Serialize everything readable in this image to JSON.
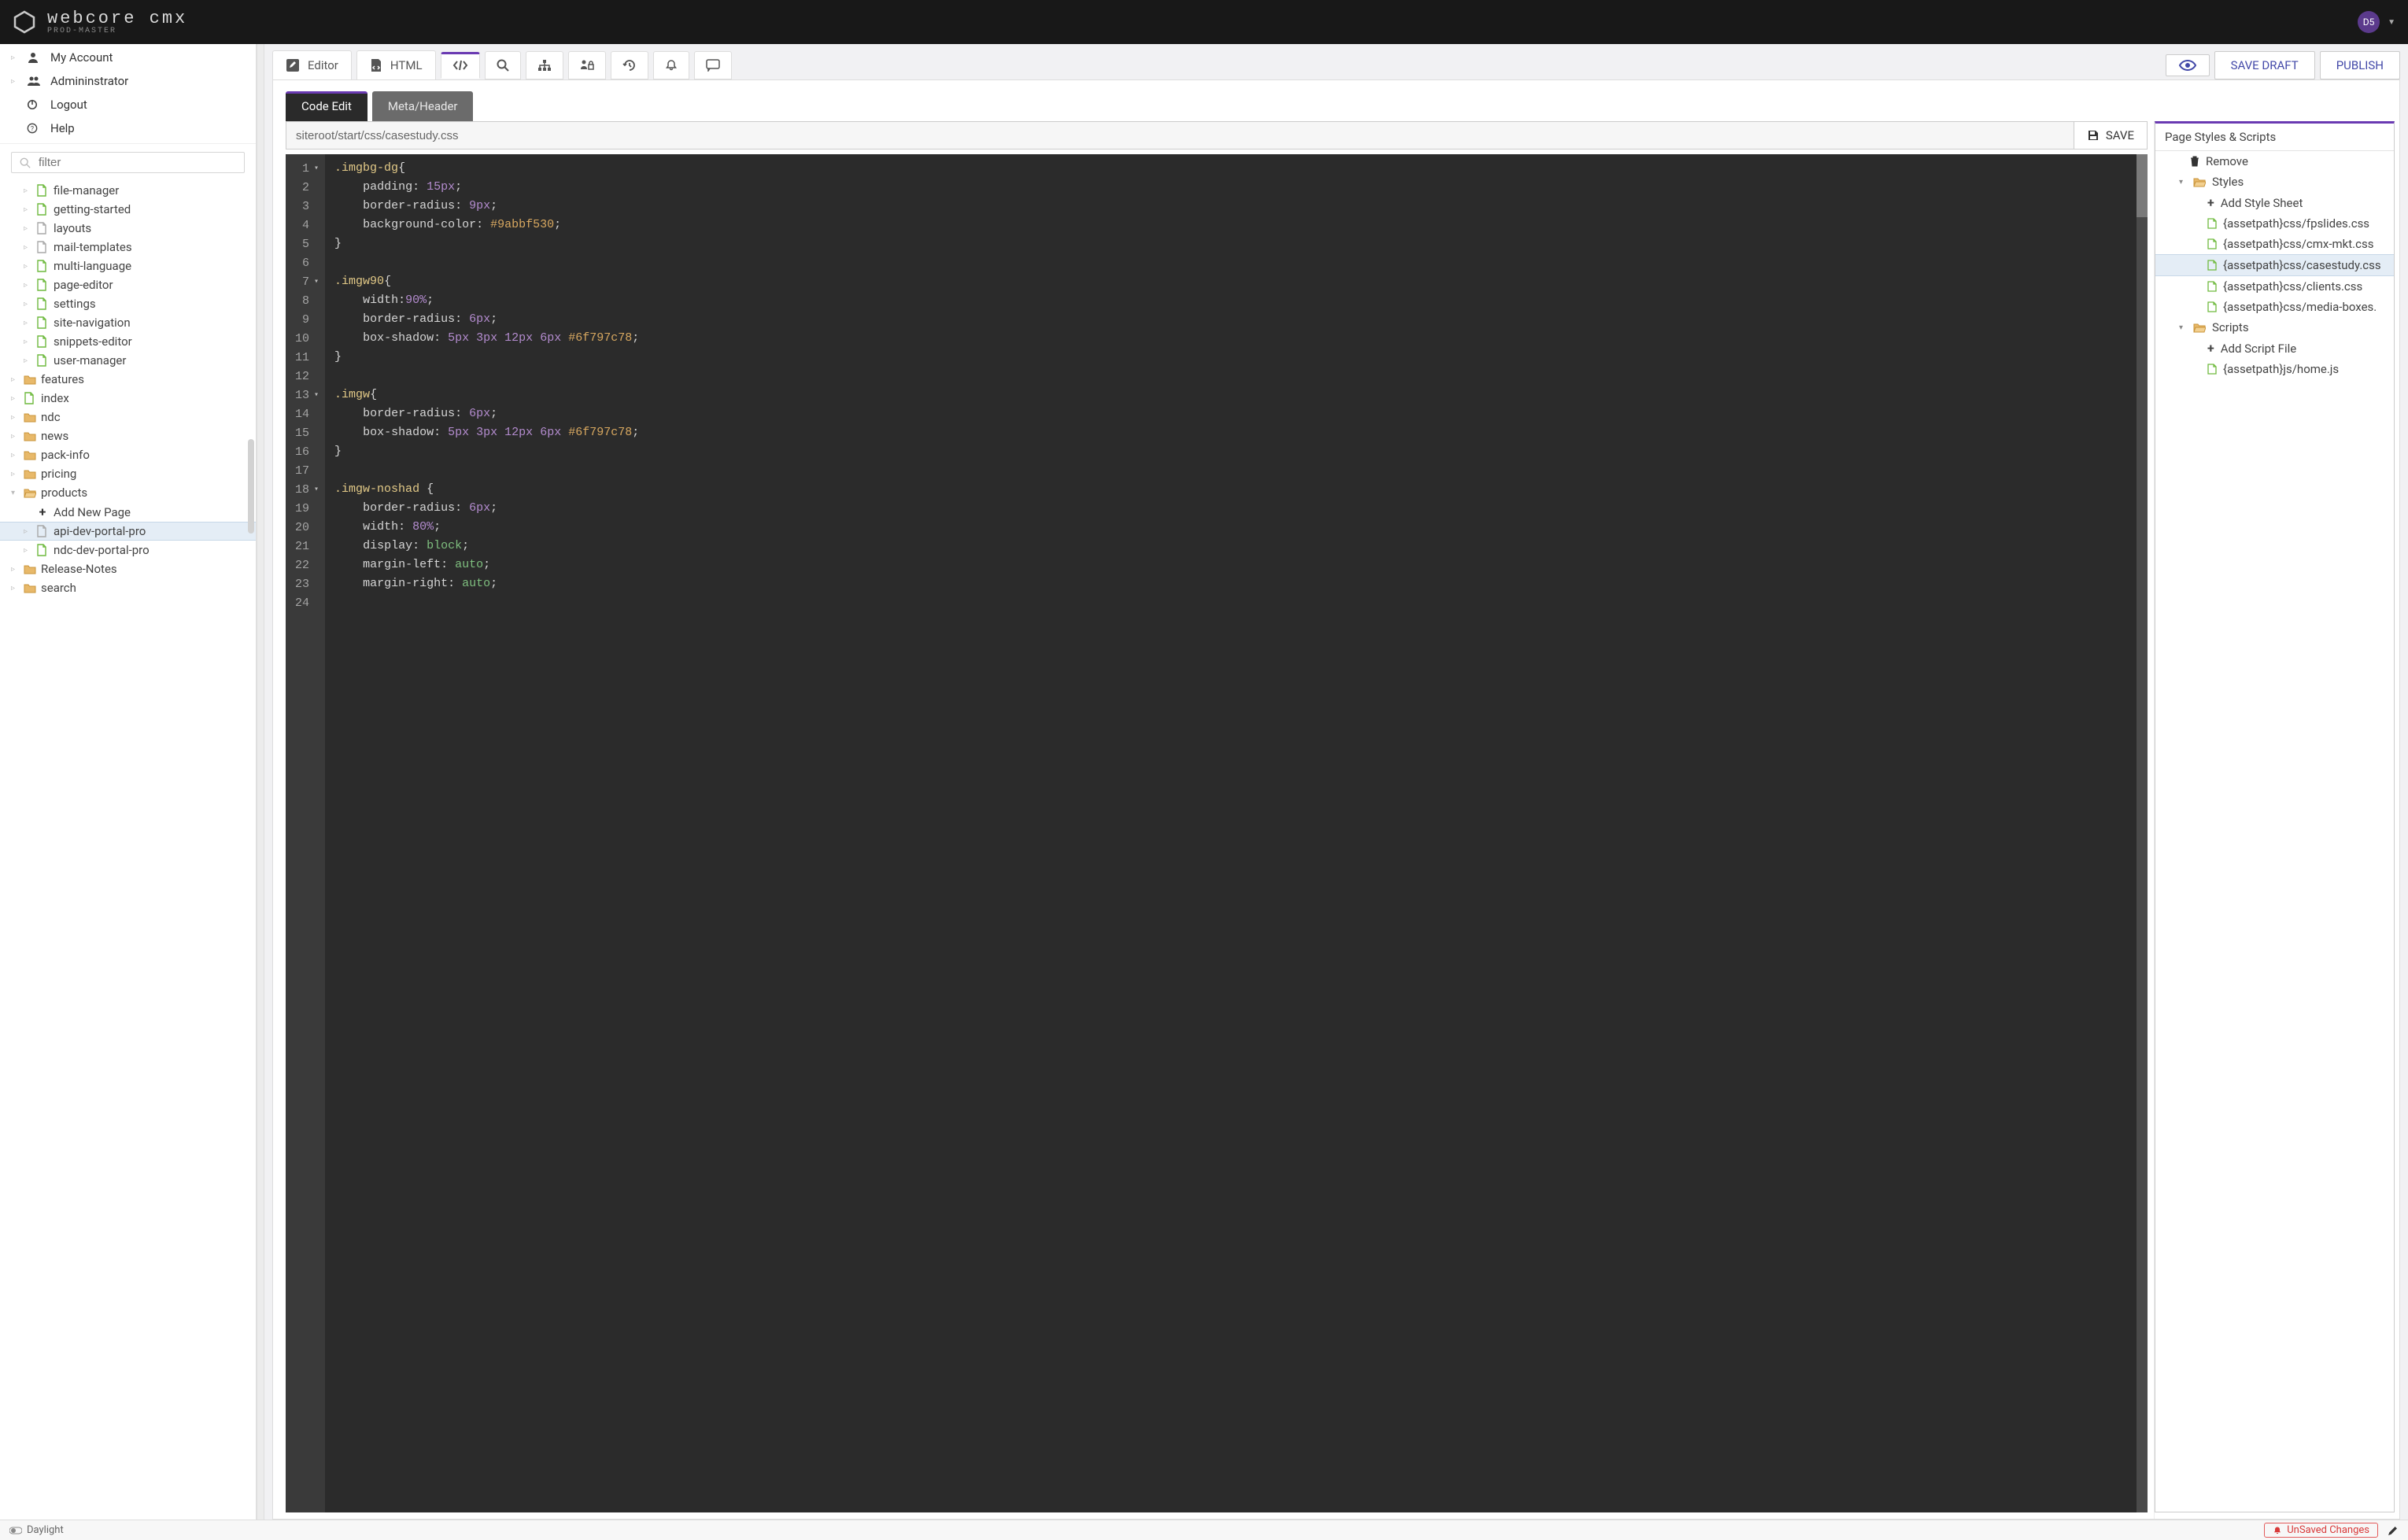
{
  "brand": {
    "name": "webcore cmx",
    "tagline": "PROD-MASTER"
  },
  "user": {
    "initials": "D5"
  },
  "sidebar": {
    "top": [
      {
        "icon": "user",
        "label": "My Account",
        "caret": true
      },
      {
        "icon": "users",
        "label": "Admininstrator",
        "caret": true
      },
      {
        "icon": "power",
        "label": "Logout",
        "caret": false
      },
      {
        "icon": "help",
        "label": "Help",
        "caret": false
      }
    ],
    "filter_placeholder": "filter",
    "tree": [
      {
        "d": 1,
        "caret": "▹",
        "icon": "page",
        "label": "file-manager"
      },
      {
        "d": 1,
        "caret": "▹",
        "icon": "page",
        "label": "getting-started"
      },
      {
        "d": 1,
        "caret": "▹",
        "icon": "page-g",
        "label": "layouts"
      },
      {
        "d": 1,
        "caret": "▹",
        "icon": "page-g",
        "label": "mail-templates"
      },
      {
        "d": 1,
        "caret": "▹",
        "icon": "page",
        "label": "multi-language"
      },
      {
        "d": 1,
        "caret": "▹",
        "icon": "page",
        "label": "page-editor"
      },
      {
        "d": 1,
        "caret": "▹",
        "icon": "page",
        "label": "settings"
      },
      {
        "d": 1,
        "caret": "▹",
        "icon": "page",
        "label": "site-navigation"
      },
      {
        "d": 1,
        "caret": "▹",
        "icon": "page",
        "label": "snippets-editor"
      },
      {
        "d": 1,
        "caret": "▹",
        "icon": "page",
        "label": "user-manager"
      },
      {
        "d": 0,
        "caret": "▹",
        "icon": "folder",
        "label": "features"
      },
      {
        "d": 0,
        "caret": "▹",
        "icon": "page",
        "label": "index"
      },
      {
        "d": 0,
        "caret": "▹",
        "icon": "folder",
        "label": "ndc"
      },
      {
        "d": 0,
        "caret": "▹",
        "icon": "folder",
        "label": "news"
      },
      {
        "d": 0,
        "caret": "▹",
        "icon": "folder",
        "label": "pack-info"
      },
      {
        "d": 0,
        "caret": "▹",
        "icon": "folder",
        "label": "pricing"
      },
      {
        "d": 0,
        "caret": "▾",
        "icon": "folder-o",
        "label": "products"
      },
      {
        "d": 1,
        "caret": "",
        "icon": "plus",
        "label": "Add New Page"
      },
      {
        "d": 1,
        "caret": "▹",
        "icon": "page-g",
        "label": "api-dev-portal-pro",
        "sel": true
      },
      {
        "d": 1,
        "caret": "▹",
        "icon": "page",
        "label": "ndc-dev-portal-pro"
      },
      {
        "d": 0,
        "caret": "▹",
        "icon": "folder",
        "label": "Release-Notes"
      },
      {
        "d": 0,
        "caret": "▹",
        "icon": "folder",
        "label": "search"
      }
    ]
  },
  "toolbar": {
    "tabs": [
      {
        "icon": "pencil-square",
        "label": "Editor"
      },
      {
        "icon": "file-code",
        "label": "HTML"
      },
      {
        "icon": "code",
        "label": "",
        "active": true
      },
      {
        "icon": "search",
        "label": ""
      },
      {
        "icon": "sitemap",
        "label": ""
      },
      {
        "icon": "perm",
        "label": ""
      },
      {
        "icon": "history",
        "label": ""
      },
      {
        "icon": "bell",
        "label": ""
      },
      {
        "icon": "comment",
        "label": ""
      }
    ],
    "actions": {
      "preview": "PREVIEW",
      "save_draft": "SAVE DRAFT",
      "publish": "PUBLISH"
    }
  },
  "subtabs": {
    "code_edit": "Code Edit",
    "meta_header": "Meta/Header"
  },
  "pathbar": {
    "path": "siteroot/start/css/casestudy.css",
    "save": "SAVE"
  },
  "editor": {
    "lines": [
      {
        "n": 1,
        "fold": "▾",
        "tokens": [
          [
            "sel",
            ".imgbg-dg"
          ],
          [
            "pun",
            "{"
          ]
        ]
      },
      {
        "n": 2,
        "fold": "",
        "tokens": [
          [
            "pad",
            "    "
          ],
          [
            "prop",
            "padding"
          ],
          [
            "pun",
            ": "
          ],
          [
            "num",
            "15px"
          ],
          [
            "pun",
            ";"
          ]
        ]
      },
      {
        "n": 3,
        "fold": "",
        "tokens": [
          [
            "pad",
            "    "
          ],
          [
            "prop",
            "border-radius"
          ],
          [
            "pun",
            ": "
          ],
          [
            "num",
            "9px"
          ],
          [
            "pun",
            ";"
          ]
        ]
      },
      {
        "n": 4,
        "fold": "",
        "tokens": [
          [
            "pad",
            "    "
          ],
          [
            "prop",
            "background-color"
          ],
          [
            "pun",
            ": "
          ],
          [
            "hex",
            "#9abbf530"
          ],
          [
            "pun",
            ";"
          ]
        ]
      },
      {
        "n": 5,
        "fold": "",
        "tokens": [
          [
            "pun",
            "}"
          ]
        ]
      },
      {
        "n": 6,
        "fold": "",
        "tokens": []
      },
      {
        "n": 7,
        "fold": "▾",
        "tokens": [
          [
            "sel",
            ".imgw90"
          ],
          [
            "pun",
            "{"
          ]
        ]
      },
      {
        "n": 8,
        "fold": "",
        "tokens": [
          [
            "pad",
            "    "
          ],
          [
            "prop",
            "width"
          ],
          [
            "pun",
            ":"
          ],
          [
            "num",
            "90%"
          ],
          [
            "pun",
            ";"
          ]
        ]
      },
      {
        "n": 9,
        "fold": "",
        "tokens": [
          [
            "pad",
            "    "
          ],
          [
            "prop",
            "border-radius"
          ],
          [
            "pun",
            ": "
          ],
          [
            "num",
            "6px"
          ],
          [
            "pun",
            ";"
          ]
        ]
      },
      {
        "n": 10,
        "fold": "",
        "tokens": [
          [
            "pad",
            "    "
          ],
          [
            "prop",
            "box-shadow"
          ],
          [
            "pun",
            ": "
          ],
          [
            "num",
            "5px"
          ],
          [
            "pun",
            " "
          ],
          [
            "num",
            "3px"
          ],
          [
            "pun",
            " "
          ],
          [
            "num",
            "12px"
          ],
          [
            "pun",
            " "
          ],
          [
            "num",
            "6px"
          ],
          [
            "pun",
            " "
          ],
          [
            "hex",
            "#6f797c78"
          ],
          [
            "pun",
            ";"
          ]
        ]
      },
      {
        "n": 11,
        "fold": "",
        "tokens": [
          [
            "pun",
            "}"
          ]
        ]
      },
      {
        "n": 12,
        "fold": "",
        "tokens": []
      },
      {
        "n": 13,
        "fold": "▾",
        "tokens": [
          [
            "sel",
            ".imgw"
          ],
          [
            "pun",
            "{"
          ]
        ]
      },
      {
        "n": 14,
        "fold": "",
        "tokens": [
          [
            "pad",
            "    "
          ],
          [
            "prop",
            "border-radius"
          ],
          [
            "pun",
            ": "
          ],
          [
            "num",
            "6px"
          ],
          [
            "pun",
            ";"
          ]
        ]
      },
      {
        "n": 15,
        "fold": "",
        "tokens": [
          [
            "pad",
            "    "
          ],
          [
            "prop",
            "box-shadow"
          ],
          [
            "pun",
            ": "
          ],
          [
            "num",
            "5px"
          ],
          [
            "pun",
            " "
          ],
          [
            "num",
            "3px"
          ],
          [
            "pun",
            " "
          ],
          [
            "num",
            "12px"
          ],
          [
            "pun",
            " "
          ],
          [
            "num",
            "6px"
          ],
          [
            "pun",
            " "
          ],
          [
            "hex",
            "#6f797c78"
          ],
          [
            "pun",
            ";"
          ]
        ]
      },
      {
        "n": 16,
        "fold": "",
        "tokens": [
          [
            "pun",
            "}"
          ]
        ]
      },
      {
        "n": 17,
        "fold": "",
        "tokens": []
      },
      {
        "n": 18,
        "fold": "▾",
        "tokens": [
          [
            "sel",
            ".imgw-noshad "
          ],
          [
            "pun",
            "{"
          ]
        ]
      },
      {
        "n": 19,
        "fold": "",
        "tokens": [
          [
            "pad",
            "    "
          ],
          [
            "prop",
            "border-radius"
          ],
          [
            "pun",
            ": "
          ],
          [
            "num",
            "6px"
          ],
          [
            "pun",
            ";"
          ]
        ]
      },
      {
        "n": 20,
        "fold": "",
        "tokens": [
          [
            "pad",
            "    "
          ],
          [
            "prop",
            "width"
          ],
          [
            "pun",
            ": "
          ],
          [
            "num",
            "80%"
          ],
          [
            "pun",
            ";"
          ]
        ]
      },
      {
        "n": 21,
        "fold": "",
        "tokens": [
          [
            "pad",
            "    "
          ],
          [
            "prop",
            "display"
          ],
          [
            "pun",
            ": "
          ],
          [
            "val",
            "block"
          ],
          [
            "pun",
            ";"
          ]
        ]
      },
      {
        "n": 22,
        "fold": "",
        "tokens": [
          [
            "pad",
            "    "
          ],
          [
            "prop",
            "margin-left"
          ],
          [
            "pun",
            ": "
          ],
          [
            "val",
            "auto"
          ],
          [
            "pun",
            ";"
          ]
        ]
      },
      {
        "n": 23,
        "fold": "",
        "tokens": [
          [
            "pad",
            "    "
          ],
          [
            "prop",
            "margin-right"
          ],
          [
            "pun",
            ": "
          ],
          [
            "val",
            "auto"
          ],
          [
            "pun",
            ";"
          ]
        ]
      },
      {
        "n": 24,
        "fold": "",
        "tokens": []
      }
    ]
  },
  "right_panel": {
    "title": "Page Styles & Scripts",
    "rows": [
      {
        "d": "d0",
        "icon": "trash",
        "label": "Remove"
      },
      {
        "d": "d1c",
        "caret": "▾",
        "icon": "folder-o",
        "label": "Styles"
      },
      {
        "d": "d2",
        "icon": "plus",
        "label": "Add Style Sheet"
      },
      {
        "d": "d2",
        "icon": "file",
        "label": "{assetpath}css/fpslides.css"
      },
      {
        "d": "d2",
        "icon": "file",
        "label": "{assetpath}css/cmx-mkt.css"
      },
      {
        "d": "d2",
        "icon": "file",
        "label": "{assetpath}css/casestudy.css",
        "sel": true
      },
      {
        "d": "d2",
        "icon": "file",
        "label": "{assetpath}css/clients.css"
      },
      {
        "d": "d2",
        "icon": "file",
        "label": "{assetpath}css/media-boxes."
      },
      {
        "d": "d1c",
        "caret": "▾",
        "icon": "folder-o",
        "label": "Scripts"
      },
      {
        "d": "d2",
        "icon": "plus",
        "label": "Add Script File"
      },
      {
        "d": "d2",
        "icon": "file",
        "label": "{assetpath}js/home.js"
      }
    ]
  },
  "footer": {
    "mode": "Daylight",
    "unsaved": "UnSaved Changes"
  }
}
